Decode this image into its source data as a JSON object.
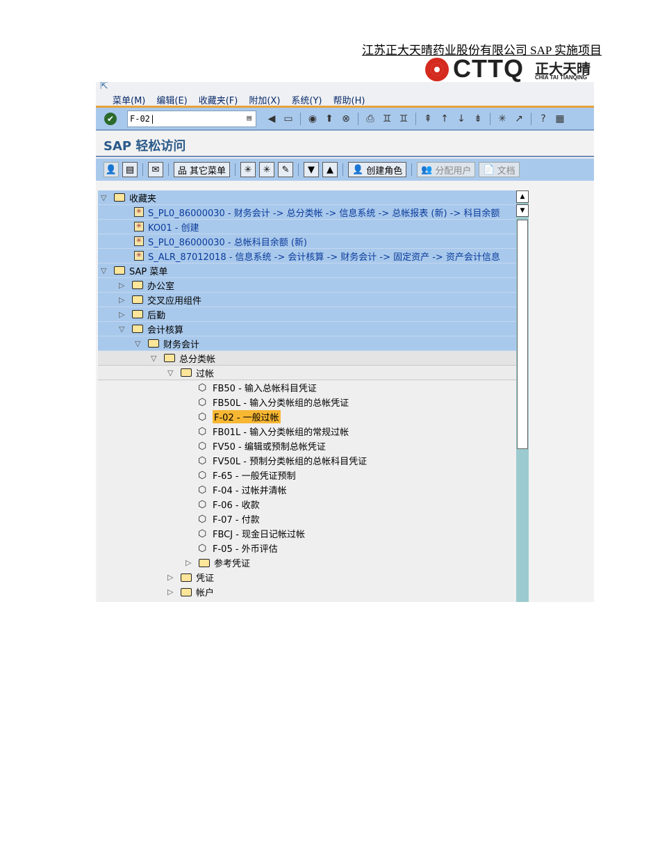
{
  "doc_header": "江苏正大天晴药业股份有限公司 SAP 实施项目",
  "logo": {
    "brand": "CTTQ",
    "cn": "正大天晴",
    "en": "CHIA TAI TIANQING"
  },
  "menu": [
    "菜单(M)",
    "编辑(E)",
    "收藏夹(F)",
    "附加(X)",
    "系统(Y)",
    "帮助(H)"
  ],
  "command_field": {
    "value": "F-02"
  },
  "page_title": "SAP 轻松访问",
  "app_toolbar": {
    "other_menu": "其它菜单",
    "create_role": "创建角色",
    "assign_users": "分配用户",
    "documentation": "文档"
  },
  "tree": [
    {
      "label": "收藏夹",
      "level": 0,
      "type": "folder-open",
      "bg": "blue"
    },
    {
      "label": "S_PL0_86000030 - 财务会计 -> 总分类帐 -> 信息系统 -> 总帐报表 (新) -> 科目余额",
      "level": 1,
      "type": "fav",
      "bg": "blue"
    },
    {
      "label": "KO01 - 创建",
      "level": 1,
      "type": "fav",
      "bg": "blue"
    },
    {
      "label": "S_PL0_86000030 - 总帐科目余额 (新)",
      "level": 1,
      "type": "fav",
      "bg": "blue"
    },
    {
      "label": "S_ALR_87012018 - 信息系统 -> 会计核算 -> 财务会计 -> 固定资产 -> 资产会计信息",
      "level": 1,
      "type": "fav",
      "bg": "blue"
    },
    {
      "label": "SAP 菜单",
      "level": 0,
      "type": "folder-open",
      "bg": "blue"
    },
    {
      "label": "办公室",
      "level": 1,
      "type": "folder",
      "bg": "blue"
    },
    {
      "label": "交叉应用组件",
      "level": 1,
      "type": "folder",
      "bg": "blue"
    },
    {
      "label": "后勤",
      "level": 1,
      "type": "folder",
      "bg": "blue"
    },
    {
      "label": "会计核算",
      "level": 1,
      "type": "folder-open",
      "bg": "blue"
    },
    {
      "label": "财务会计",
      "level": 2,
      "type": "folder-open",
      "bg": "blue"
    },
    {
      "label": "总分类帐",
      "level": 3,
      "type": "folder-open",
      "bg": "g1"
    },
    {
      "label": "过帐",
      "level": 4,
      "type": "folder-open",
      "bg": "g2"
    },
    {
      "label": "FB50 - 输入总帐科目凭证",
      "level": 5,
      "type": "tx",
      "bg": ""
    },
    {
      "label": "FB50L - 输入分类帐组的总帐凭证",
      "level": 5,
      "type": "tx",
      "bg": ""
    },
    {
      "label": "F-02 - 一般过帐",
      "level": 5,
      "type": "tx",
      "bg": "",
      "selected": true
    },
    {
      "label": "FB01L - 输入分类帐组的常规过帐",
      "level": 5,
      "type": "tx",
      "bg": ""
    },
    {
      "label": "FV50 - 编辑或预制总帐凭证",
      "level": 5,
      "type": "tx",
      "bg": ""
    },
    {
      "label": "FV50L - 预制分类帐组的总帐科目凭证",
      "level": 5,
      "type": "tx",
      "bg": ""
    },
    {
      "label": "F-65 - 一般凭证预制",
      "level": 5,
      "type": "tx",
      "bg": ""
    },
    {
      "label": "F-04 - 过帐并清帐",
      "level": 5,
      "type": "tx",
      "bg": ""
    },
    {
      "label": "F-06 - 收款",
      "level": 5,
      "type": "tx",
      "bg": ""
    },
    {
      "label": "F-07 - 付款",
      "level": 5,
      "type": "tx",
      "bg": ""
    },
    {
      "label": "FBCJ - 现金日记帐过帐",
      "level": 5,
      "type": "tx",
      "bg": ""
    },
    {
      "label": "F-05 - 外币评估",
      "level": 5,
      "type": "tx",
      "bg": ""
    },
    {
      "label": "参考凭证",
      "level": 5,
      "type": "folder",
      "bg": ""
    },
    {
      "label": "凭证",
      "level": 4,
      "type": "folder",
      "bg": ""
    },
    {
      "label": "帐户",
      "level": 4,
      "type": "folder",
      "bg": ""
    }
  ]
}
